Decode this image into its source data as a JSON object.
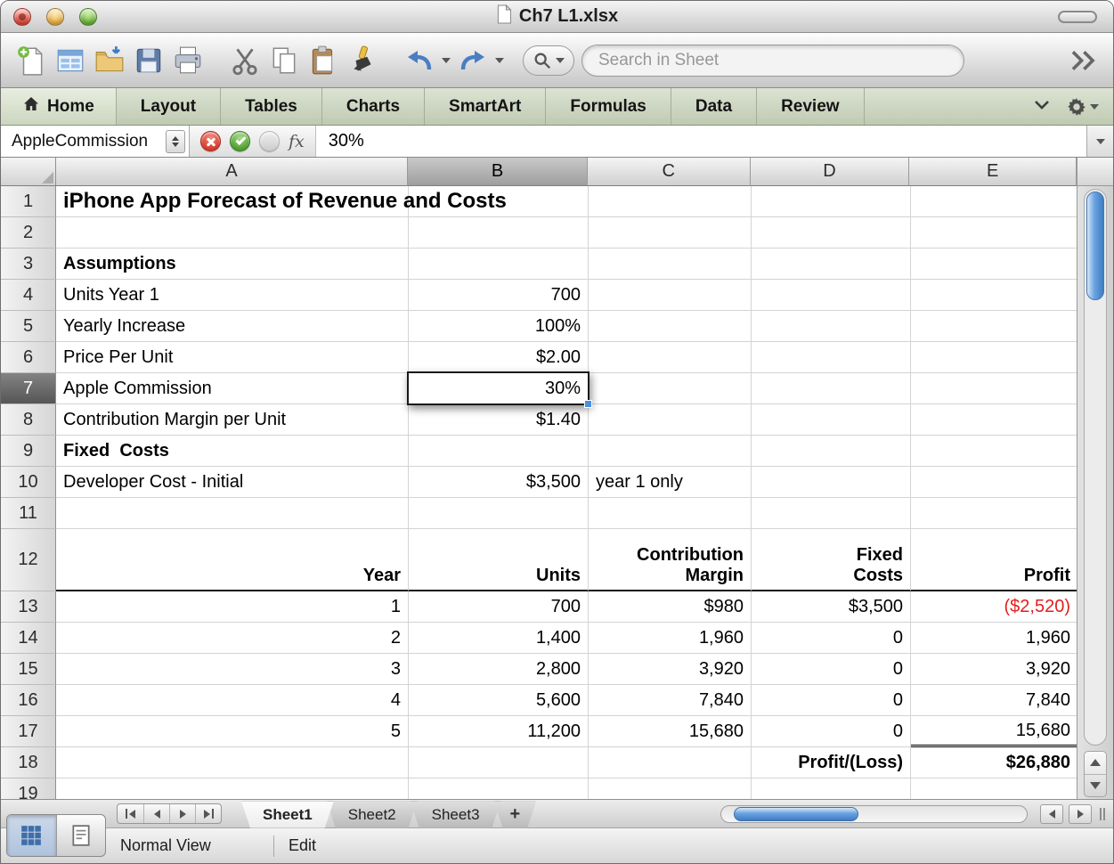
{
  "window": {
    "title": "Ch7 L1.xlsx"
  },
  "toolbar": {
    "search_placeholder": "Search in Sheet",
    "icons": [
      "new-document-icon",
      "gallery-icon",
      "open-icon",
      "save-icon",
      "print-icon",
      "cut-icon",
      "copy-icon",
      "paste-icon",
      "format-painter-icon",
      "undo-icon",
      "redo-icon",
      "search-icon",
      "overflow-chevron-icon"
    ]
  },
  "ribbon": {
    "tabs": [
      "Home",
      "Layout",
      "Tables",
      "Charts",
      "SmartArt",
      "Formulas",
      "Data",
      "Review"
    ]
  },
  "formula_bar": {
    "name_box": "AppleCommission",
    "fx_label": "fx",
    "value": "30%",
    "icons": [
      "cancel-icon",
      "accept-icon",
      "insert-function-icon"
    ]
  },
  "grid": {
    "columns": [
      "A",
      "B",
      "C",
      "D",
      "E"
    ],
    "selected_column": "B",
    "selected_row": 7,
    "selection": {
      "cell": "B7",
      "value": "30%"
    },
    "rows": [
      {
        "n": 1,
        "A": "iPhone App Forecast of Revenue and Costs"
      },
      {
        "n": 2
      },
      {
        "n": 3,
        "A": "Assumptions"
      },
      {
        "n": 4,
        "A": "Units Year 1",
        "B": "700"
      },
      {
        "n": 5,
        "A": "Yearly Increase",
        "B": "100%"
      },
      {
        "n": 6,
        "A": "Price Per Unit",
        "B": "$2.00"
      },
      {
        "n": 7,
        "A": "Apple Commission",
        "B": "30%"
      },
      {
        "n": 8,
        "A": "Contribution Margin per Unit",
        "B": "$1.40"
      },
      {
        "n": 9,
        "A": "Fixed  Costs"
      },
      {
        "n": 10,
        "A": "Developer Cost - Initial",
        "B": "$3,500",
        "C": "year 1 only"
      },
      {
        "n": 11
      },
      {
        "n": 12,
        "A": "Year",
        "B": "Units",
        "C": "Contribution\nMargin",
        "D": "Fixed\nCosts",
        "E": "Profit"
      },
      {
        "n": 13,
        "A": "1",
        "B": "700",
        "C": "$980",
        "D": "$3,500",
        "E": "($2,520)"
      },
      {
        "n": 14,
        "A": "2",
        "B": "1,400",
        "C": "1,960",
        "D": "0",
        "E": "1,960"
      },
      {
        "n": 15,
        "A": "3",
        "B": "2,800",
        "C": "3,920",
        "D": "0",
        "E": "3,920"
      },
      {
        "n": 16,
        "A": "4",
        "B": "5,600",
        "C": "7,840",
        "D": "0",
        "E": "7,840"
      },
      {
        "n": 17,
        "A": "5",
        "B": "11,200",
        "C": "15,680",
        "D": "0",
        "E": "15,680"
      },
      {
        "n": 18,
        "D": "Profit/(Loss)",
        "E": "$26,880"
      },
      {
        "n": 19
      }
    ]
  },
  "sheet_bar": {
    "tabs": [
      "Sheet1",
      "Sheet2",
      "Sheet3"
    ],
    "add_label": "+",
    "active_tab": "Sheet1"
  },
  "status_bar": {
    "view": "Normal View",
    "mode": "Edit"
  },
  "colors": {
    "negative_number": "#e02020",
    "selection_handle": "#4a8fe2",
    "aqua_scrollbar": "#5f9ad8",
    "ribbon_green": "#ccd6c3"
  }
}
